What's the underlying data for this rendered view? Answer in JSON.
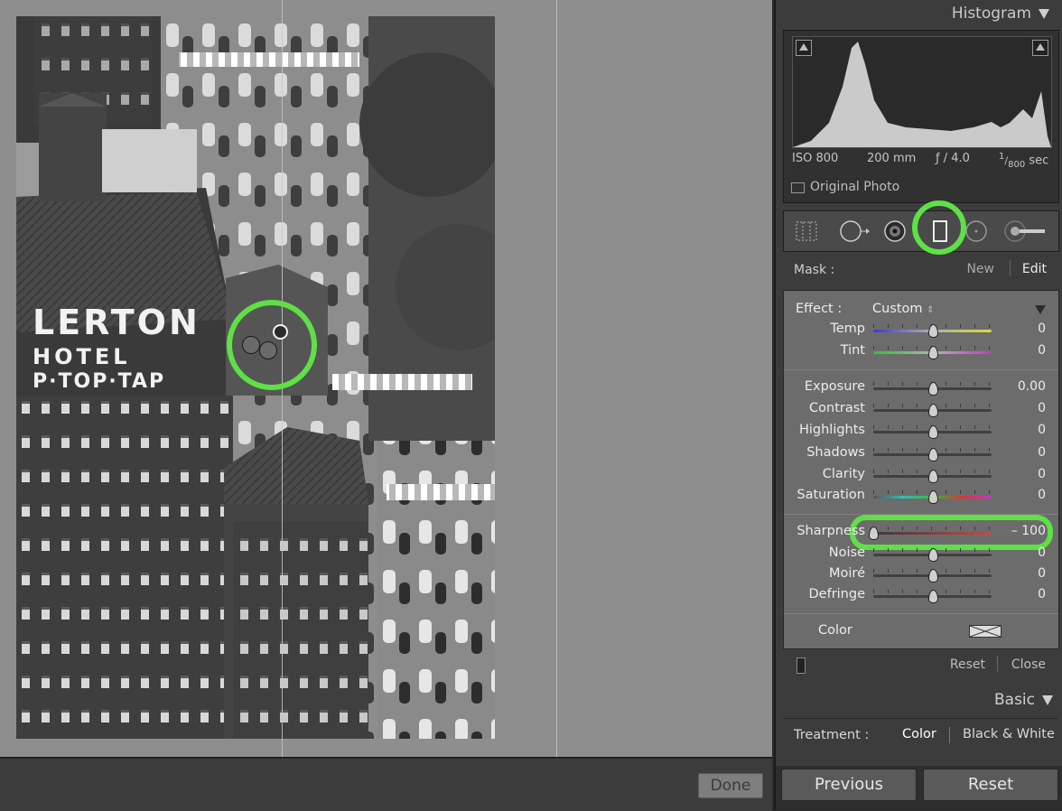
{
  "canvas": {
    "done_label": "Done",
    "photo_sign_lines": [
      "LERTON",
      "HOTEL",
      "P·TOP·TAP"
    ]
  },
  "panel": {
    "histogram": {
      "title": "Histogram",
      "iso": "ISO 800",
      "focal": "200 mm",
      "aperture": "ƒ / 4.0",
      "shutter_num": "1",
      "shutter_den": "800",
      "shutter_unit": "sec",
      "original_photo_label": "Original Photo"
    },
    "tools": [
      "crop-overlay-icon",
      "spot-removal-icon",
      "red-eye-icon",
      "graduated-filter-icon",
      "radial-filter-icon",
      "adjustment-brush-icon"
    ],
    "mask": {
      "label": "Mask :",
      "new_label": "New",
      "edit_label": "Edit"
    },
    "effect": {
      "label": "Effect :",
      "value": "Custom"
    },
    "sliders": [
      {
        "label": "Temp",
        "value": "0",
        "pos": 0.5
      },
      {
        "label": "Tint",
        "value": "0",
        "pos": 0.5
      },
      {
        "label": "Exposure",
        "value": "0.00",
        "pos": 0.5
      },
      {
        "label": "Contrast",
        "value": "0",
        "pos": 0.5
      },
      {
        "label": "Highlights",
        "value": "0",
        "pos": 0.5
      },
      {
        "label": "Shadows",
        "value": "0",
        "pos": 0.5
      },
      {
        "label": "Clarity",
        "value": "0",
        "pos": 0.5
      },
      {
        "label": "Saturation",
        "value": "0",
        "pos": 0.5
      },
      {
        "label": "Sharpness",
        "value": "– 100",
        "pos": 0.0
      },
      {
        "label": "Noise",
        "value": "0",
        "pos": 0.5
      },
      {
        "label": "Moiré",
        "value": "0",
        "pos": 0.5
      },
      {
        "label": "Defringe",
        "value": "0",
        "pos": 0.5
      }
    ],
    "color_label": "Color",
    "footer": {
      "reset_label": "Reset",
      "close_label": "Close"
    },
    "basic": {
      "title": "Basic",
      "treatment_label": "Treatment :",
      "color_option": "Color",
      "bw_option": "Black & White"
    },
    "buttons": {
      "previous_label": "Previous",
      "reset_label": "Reset"
    },
    "highlight_color": "#5ee046"
  }
}
